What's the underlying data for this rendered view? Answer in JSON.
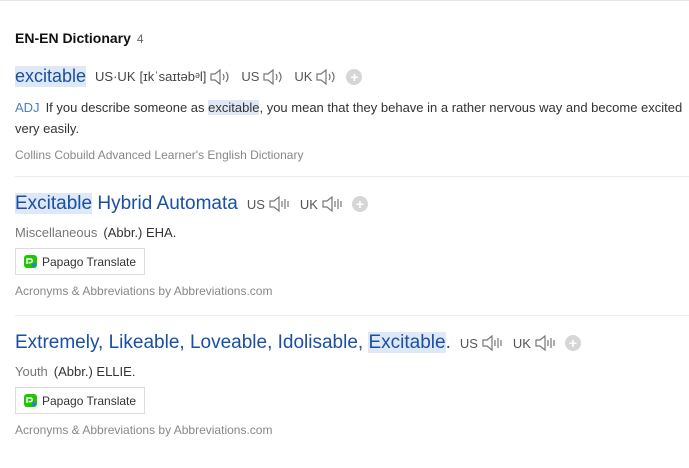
{
  "section": {
    "title": "EN-EN Dictionary",
    "count": "4"
  },
  "entries": [
    {
      "word": "excitable",
      "pron_label": "US·UK",
      "pron": "[ɪkˈsaɪtəbᵊl]",
      "audio": [
        "US",
        "UK"
      ],
      "pos": "ADJ",
      "def_pre": "If you describe someone as ",
      "def_hl": "excitable",
      "def_post": ", you mean that they behave in a rather nervous way and become excited very easily.",
      "source": "Collins Cobuild Advanced Learner's English Dictionary"
    },
    {
      "word_hl": "Excitable",
      "word_rest": " Hybrid Automata",
      "audio": [
        "US",
        "UK"
      ],
      "category": "Miscellaneous",
      "meaning": "(Abbr.) EHA.",
      "translate_label": "Papago Translate",
      "source": "Acronyms & Abbreviations by Abbreviations.com"
    },
    {
      "word_pre": "Extremely, Likeable, Loveable, Idolisable, ",
      "word_hl": "Excitable",
      "word_post": ".",
      "audio": [
        "US",
        "UK"
      ],
      "category": "Youth",
      "meaning": "(Abbr.) ELLIE.",
      "translate_label": "Papago Translate",
      "source": "Acronyms & Abbreviations by Abbreviations.com"
    }
  ],
  "colors": {
    "link": "#1a4fa3",
    "highlight": "#dfe8f6",
    "pos": "#4f7ec9",
    "muted": "#888888"
  },
  "icons": {
    "audio": "speaker-icon",
    "add": "plus-icon",
    "papago": "papago-icon"
  }
}
